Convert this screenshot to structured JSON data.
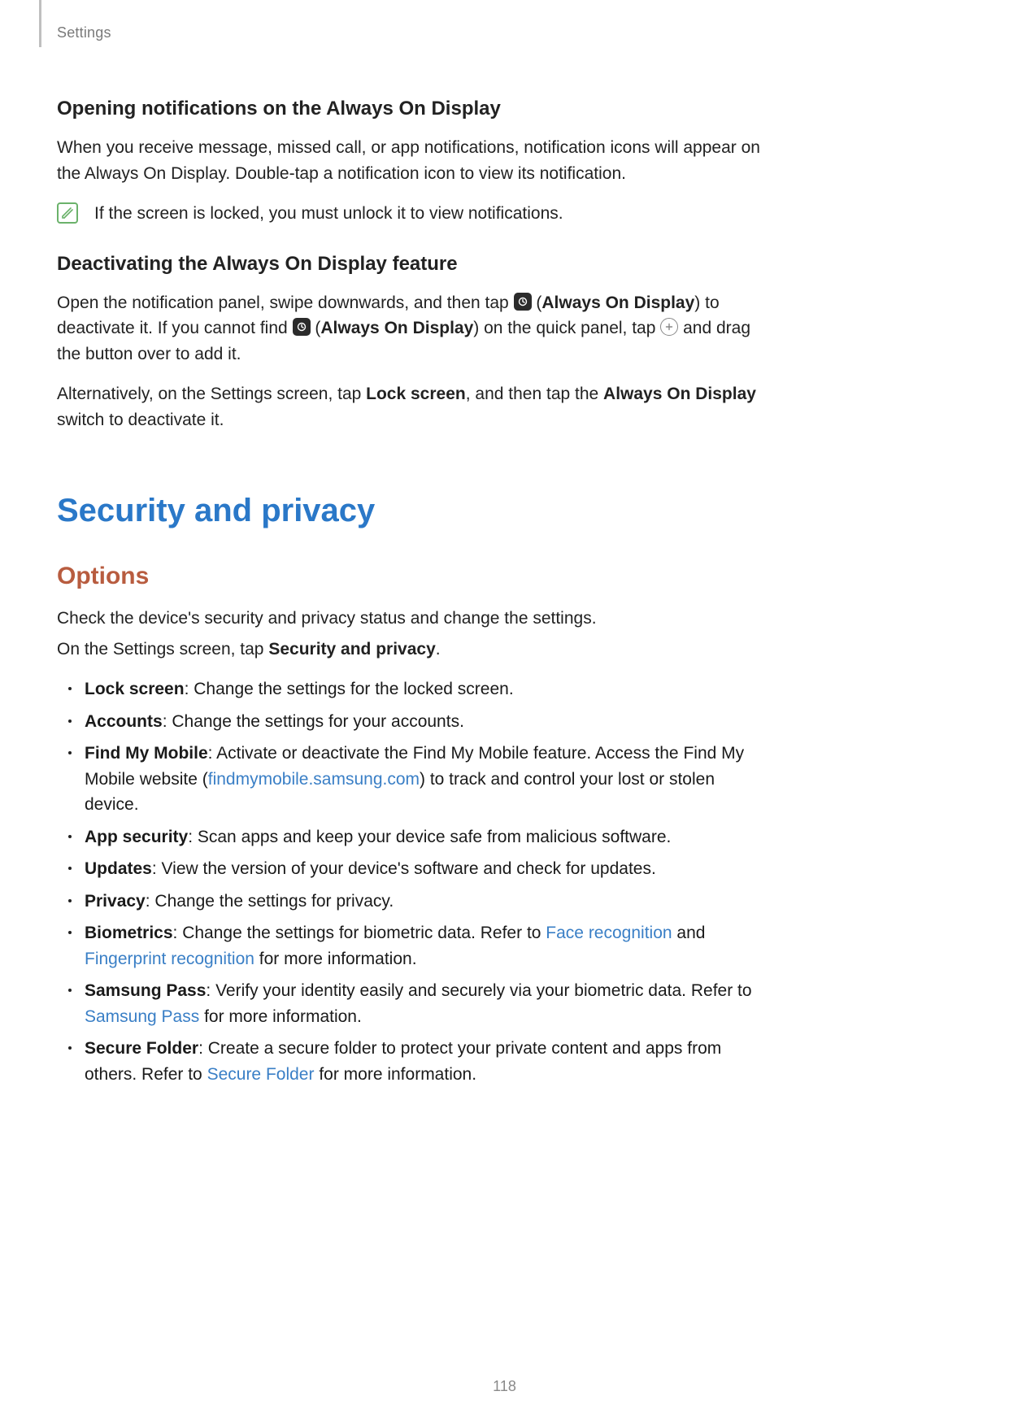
{
  "header": {
    "section": "Settings"
  },
  "section1": {
    "heading": "Opening notifications on the Always On Display",
    "para": "When you receive message, missed call, or app notifications, notification icons will appear on the Always On Display. Double-tap a notification icon to view its notification.",
    "note": "If the screen is locked, you must unlock it to view notifications."
  },
  "section2": {
    "heading": "Deactivating the Always On Display feature",
    "p1_a": "Open the notification panel, swipe downwards, and then tap ",
    "p1_b": " (",
    "p1_bold1": "Always On Display",
    "p1_c": ") to deactivate it. If you cannot find ",
    "p1_d": " (",
    "p1_bold2": "Always On Display",
    "p1_e": ") on the quick panel, tap ",
    "p1_f": " and drag the button over to add it.",
    "p2_a": "Alternatively, on the Settings screen, tap ",
    "p2_bold1": "Lock screen",
    "p2_b": ", and then tap the ",
    "p2_bold2": "Always On Display",
    "p2_c": " switch to deactivate it."
  },
  "title": "Security and privacy",
  "options": {
    "heading": "Options",
    "intro1": "Check the device's security and privacy status and change the settings.",
    "intro2_a": "On the Settings screen, tap ",
    "intro2_bold": "Security and privacy",
    "intro2_b": ".",
    "items": [
      {
        "bold": "Lock screen",
        "text": ": Change the settings for the locked screen."
      },
      {
        "bold": "Accounts",
        "text": ": Change the settings for your accounts."
      },
      {
        "bold": "Find My Mobile",
        "text_a": ": Activate or deactivate the Find My Mobile feature. Access the Find My Mobile website (",
        "link1": "findmymobile.samsung.com",
        "text_b": ") to track and control your lost or stolen device."
      },
      {
        "bold": "App security",
        "text": ": Scan apps and keep your device safe from malicious software."
      },
      {
        "bold": "Updates",
        "text": ": View the version of your device's software and check for updates."
      },
      {
        "bold": "Privacy",
        "text": ": Change the settings for privacy."
      },
      {
        "bold": "Biometrics",
        "text_a": ": Change the settings for biometric data. Refer to ",
        "link1": "Face recognition",
        "text_b": " and ",
        "link2": "Fingerprint recognition",
        "text_c": " for more information."
      },
      {
        "bold": "Samsung Pass",
        "text_a": ": Verify your identity easily and securely via your biometric data. Refer to ",
        "link1": "Samsung Pass",
        "text_b": " for more information."
      },
      {
        "bold": "Secure Folder",
        "text_a": ": Create a secure folder to protect your private content and apps from others. Refer to ",
        "link1": "Secure Folder",
        "text_b": " for more information."
      }
    ]
  },
  "page_number": "118"
}
